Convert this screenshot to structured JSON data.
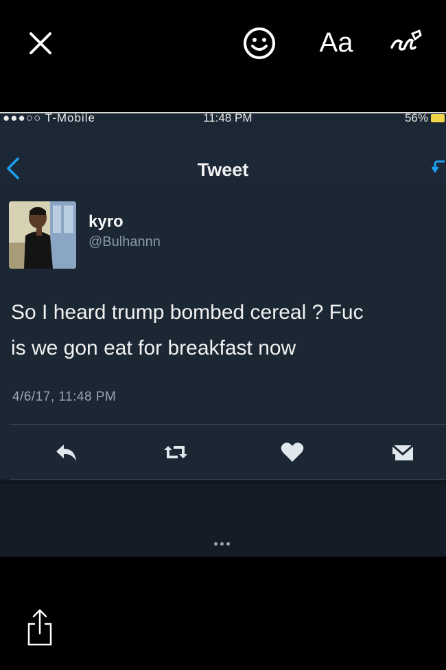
{
  "toolbar": {
    "close_icon": "close-icon",
    "emoji_icon": "smiley-icon",
    "text_label": "Aa",
    "draw_icon": "scribble-pen-icon"
  },
  "status_bar": {
    "carrier": "●●●○○ T-Mobile",
    "time": "11:48 PM",
    "battery": "56%"
  },
  "nav": {
    "title": "Tweet",
    "back_icon": "chevron-left-icon",
    "reply_icon": "reply-arrow-icon"
  },
  "tweet": {
    "display_name": "kyro",
    "handle": "@Bulhannn",
    "text_line_1": "So I heard trump bombed cereal ? Fuc",
    "text_line_2": "is we gon eat for breakfast now",
    "date": "4/6/17, 11:48 PM",
    "actions": [
      "reply-icon",
      "retweet-icon",
      "heart-icon",
      "direct-message-icon"
    ]
  },
  "bottom": {
    "share_icon": "share-icon"
  },
  "colors": {
    "accent": "#1da1f2",
    "background": "#1b2733",
    "battery": "#f2d34a"
  }
}
